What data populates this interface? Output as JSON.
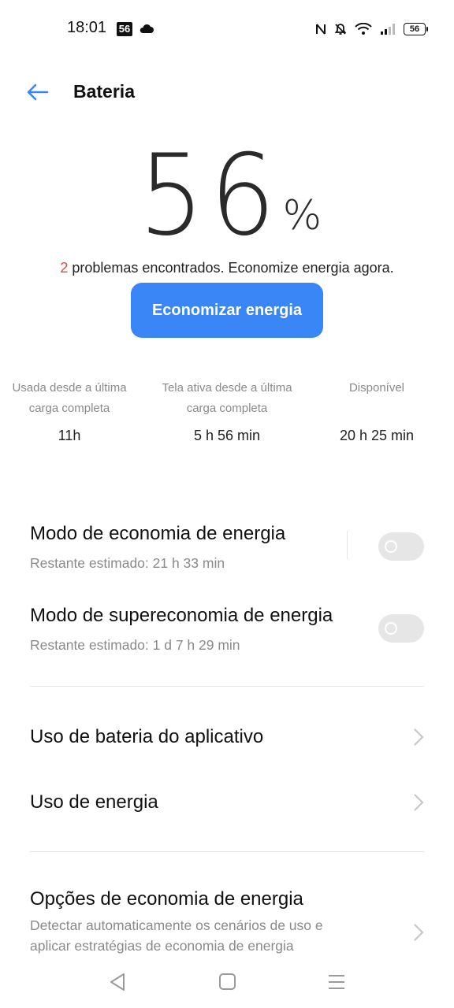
{
  "status_bar": {
    "time": "18:01",
    "network_badge": "56",
    "battery_level": "56",
    "icons": [
      "cloud-icon",
      "nfc-icon",
      "bell-muted-icon",
      "wifi-icon",
      "signal-icon",
      "battery-icon"
    ]
  },
  "header": {
    "back_icon": "back-arrow-icon",
    "title": "Bateria"
  },
  "battery": {
    "level": "56",
    "unit": "%",
    "problems_count": "2",
    "problems_text": " problemas encontrados. Economize energia agora.",
    "save_button": "Economizar energia"
  },
  "stats": [
    {
      "label": "Usada desde a última carga completa",
      "value": "11h"
    },
    {
      "label": "Tela ativa desde a última carga completa",
      "value": "5 h 56 min"
    },
    {
      "label": "Disponível",
      "value": "20 h 25 min"
    }
  ],
  "modes": [
    {
      "title": "Modo de economia de energia",
      "subtitle": "Restante estimado:  21 h 33 min",
      "enabled": false
    },
    {
      "title": "Modo de supereconomia de energia",
      "subtitle": "Restante estimado:  1 d 7 h 29 min",
      "enabled": false
    }
  ],
  "links": [
    {
      "title": "Uso de bateria do aplicativo"
    },
    {
      "title": "Uso de energia"
    },
    {
      "title": "Opções de economia de energia",
      "subtitle": "Detectar automaticamente os cenários de uso e aplicar estratégias de economia de energia"
    }
  ],
  "nav": [
    "back-nav-icon",
    "home-nav-icon",
    "recents-nav-icon"
  ],
  "colors": {
    "accent": "#3a86f7",
    "problem": "#e0483e",
    "toggle_off": "#e6e6e6"
  }
}
